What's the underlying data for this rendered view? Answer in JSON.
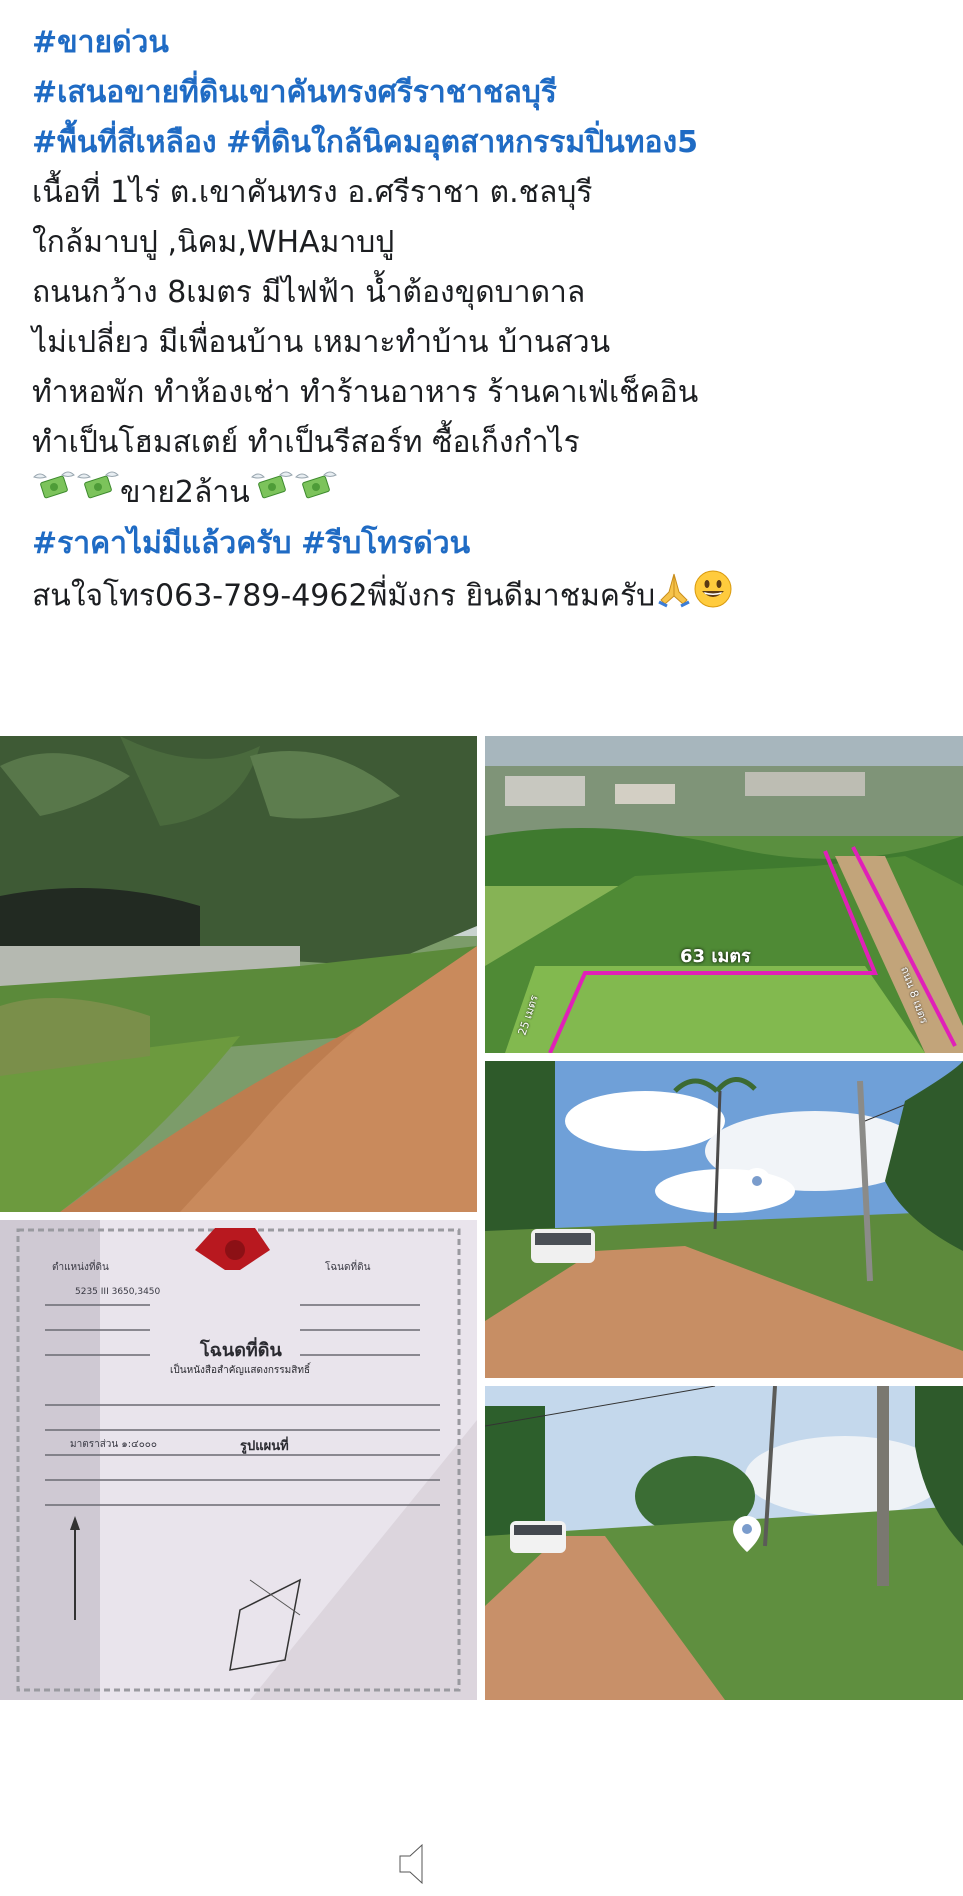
{
  "post": {
    "hashtag_line_1": "#ขายด่วน",
    "hashtag_line_2": "#เสนอขายที่ดินเขาคันทรงศรีราชาชลบุรี",
    "hashtag_line_3a": "#พื้นที่สีเหลือง",
    "hashtag_line_3b": "#ที่ดินใกล้นิคมอุตสาหกรรมปิ่นทอง5",
    "line_area": "เนื้อที่ 1ไร่ ต.เขาคันทรง อ.ศรีราชา ต.ชลบุรี",
    "line_near": "ใกล้มาบปู ,นิคม,WHAมาบปู",
    "line_road": "ถนนกว้าง 8เมตร มีไฟฟ้า น้ำต้องขุดบาดาล",
    "line_quiet": "ไม่เปลี่ยว มีเพื่อนบ้าน เหมาะทำบ้าน บ้านสวน",
    "line_uses_1": "ทำหอพัก ทำห้องเช่า ทำร้านอาหาร ร้านคาเฟ่เช็คอิน",
    "line_uses_2": "ทำเป็นโฮมสเตย์ ทำเป็นรีสอร์ท ซื้อเก็งกำไร",
    "price": "ขาย2ล้าน",
    "hashtag_line_4a": "#ราคาไม่มีแล้วครับ",
    "hashtag_line_4b": "#รีบโทรด่วน",
    "contact": "สนใจโทร063-789-4962พี่มังกร ยินดีมาชมครับ"
  },
  "icons": {
    "money": "money-with-wings-icon",
    "pray": "folded-hands-icon",
    "smile": "grinning-face-icon",
    "mute": "speaker-muted-icon",
    "pin": "location-pin-icon"
  },
  "gallery": {
    "aerial_label": "63 เมตร",
    "aerial_side_left": "25 เมตร",
    "aerial_side_right": "ถนน 8 เมตร",
    "deed_title": "โฉนดที่ดิน",
    "deed_subtitle": "เป็นหนังสือสำคัญแสดงกรรมสิทธิ์",
    "deed_position": "ตำแหน่งที่ดิน",
    "deed_sheet": "5235 III 3650,3450",
    "deed_land_no": "โฉนดที่ดิน",
    "deed_scale": "มาตราส่วน ๑:๔๐๐๐",
    "deed_plan": "รูปแผนที่"
  },
  "colors": {
    "text": "#1c1e21",
    "hashtag": "#1f6bc4",
    "boundary": "#e020b8"
  }
}
